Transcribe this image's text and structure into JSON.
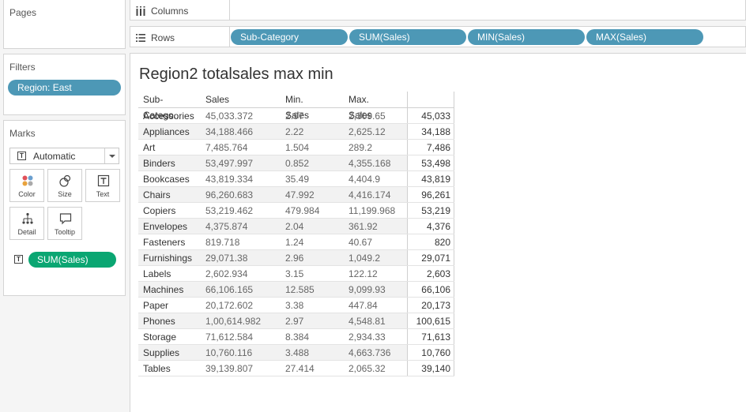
{
  "pages": {
    "title": "Pages"
  },
  "filters": {
    "title": "Filters",
    "pill": "Region: East"
  },
  "marks": {
    "title": "Marks",
    "type": "Automatic",
    "buttons": [
      "Color",
      "Size",
      "Text",
      "Detail",
      "Tooltip"
    ],
    "field_pill": "SUM(Sales)"
  },
  "shelves": {
    "columns_label": "Columns",
    "rows_label": "Rows",
    "rows_pills": [
      "Sub-Category",
      "SUM(Sales)",
      "MIN(Sales)",
      "MAX(Sales)"
    ]
  },
  "viz": {
    "title": "Region2 totalsales max min",
    "headers": [
      "Sub-Catego..",
      "Sales",
      "Min. Sales",
      "Max. Sales"
    ],
    "rows": [
      [
        "Accessories",
        "45,033.372",
        "2.97",
        "2,309.65",
        "45,033"
      ],
      [
        "Appliances",
        "34,188.466",
        "2.22",
        "2,625.12",
        "34,188"
      ],
      [
        "Art",
        "7,485.764",
        "1.504",
        "289.2",
        "7,486"
      ],
      [
        "Binders",
        "53,497.997",
        "0.852",
        "4,355.168",
        "53,498"
      ],
      [
        "Bookcases",
        "43,819.334",
        "35.49",
        "4,404.9",
        "43,819"
      ],
      [
        "Chairs",
        "96,260.683",
        "47.992",
        "4,416.174",
        "96,261"
      ],
      [
        "Copiers",
        "53,219.462",
        "479.984",
        "11,199.968",
        "53,219"
      ],
      [
        "Envelopes",
        "4,375.874",
        "2.04",
        "361.92",
        "4,376"
      ],
      [
        "Fasteners",
        "819.718",
        "1.24",
        "40.67",
        "820"
      ],
      [
        "Furnishings",
        "29,071.38",
        "2.96",
        "1,049.2",
        "29,071"
      ],
      [
        "Labels",
        "2,602.934",
        "3.15",
        "122.12",
        "2,603"
      ],
      [
        "Machines",
        "66,106.165",
        "12.585",
        "9,099.93",
        "66,106"
      ],
      [
        "Paper",
        "20,172.602",
        "3.38",
        "447.84",
        "20,173"
      ],
      [
        "Phones",
        "1,00,614.982",
        "2.97",
        "4,548.81",
        "100,615"
      ],
      [
        "Storage",
        "71,612.584",
        "8.384",
        "2,934.33",
        "71,613"
      ],
      [
        "Supplies",
        "10,760.116",
        "3.488",
        "4,663.736",
        "10,760"
      ],
      [
        "Tables",
        "39,139.807",
        "27.414",
        "2,065.32",
        "39,140"
      ]
    ]
  },
  "colors": {
    "pill_blue": "#4d98b6",
    "pill_green": "#0aa672"
  }
}
